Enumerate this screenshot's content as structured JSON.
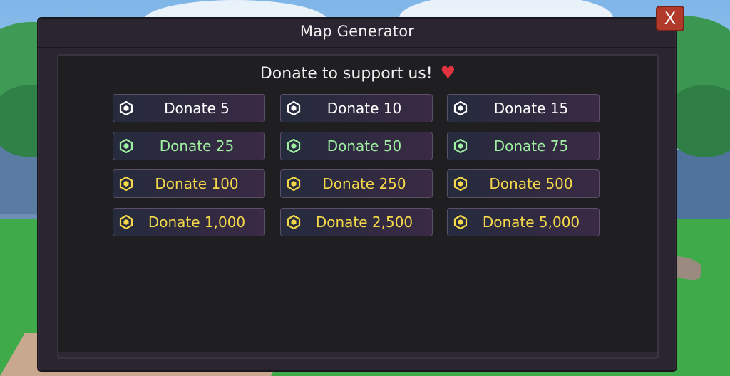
{
  "window": {
    "title": "Map Generator",
    "close_label": "X"
  },
  "heading": {
    "text": "Donate to support us!",
    "heart": "♥",
    "heart_color": "#e0323f"
  },
  "colors": {
    "white": "#ffffff",
    "green": "#9ff0a0",
    "gold": "#f4d84a",
    "close": "#b13a2b"
  },
  "donate_buttons": [
    {
      "label": "Donate 5",
      "tier": "white",
      "icon": "robux-icon"
    },
    {
      "label": "Donate 10",
      "tier": "white",
      "icon": "robux-icon"
    },
    {
      "label": "Donate 15",
      "tier": "white",
      "icon": "robux-icon"
    },
    {
      "label": "Donate 25",
      "tier": "green",
      "icon": "robux-icon"
    },
    {
      "label": "Donate 50",
      "tier": "green",
      "icon": "robux-icon"
    },
    {
      "label": "Donate 75",
      "tier": "green",
      "icon": "robux-icon"
    },
    {
      "label": "Donate 100",
      "tier": "gold",
      "icon": "robux-icon"
    },
    {
      "label": "Donate 250",
      "tier": "gold",
      "icon": "robux-icon"
    },
    {
      "label": "Donate 500",
      "tier": "gold",
      "icon": "robux-icon"
    },
    {
      "label": "Donate 1,000",
      "tier": "gold",
      "icon": "robux-icon"
    },
    {
      "label": "Donate 2,500",
      "tier": "gold",
      "icon": "robux-icon"
    },
    {
      "label": "Donate 5,000",
      "tier": "gold",
      "icon": "robux-icon"
    }
  ]
}
